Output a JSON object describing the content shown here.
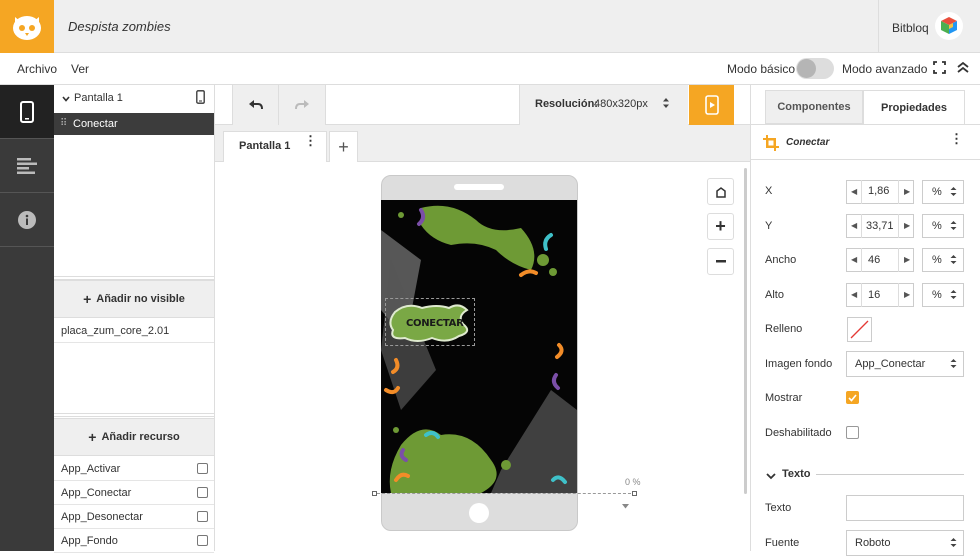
{
  "header": {
    "project_title": "Despista zombies",
    "user_name": "Bitbloq"
  },
  "menu": {
    "file": "Archivo",
    "view": "Ver",
    "mode_basic": "Modo básico",
    "mode_advanced": "Modo avanzado"
  },
  "tree": {
    "screen_label": "Pantalla 1",
    "selected_item": "Conectar"
  },
  "hidden": {
    "add_button": "Añadir no visible",
    "items": [
      "placa_zum_core_2.01"
    ]
  },
  "resources": {
    "add_button": "Añadir recurso",
    "items": [
      "App_Activar",
      "App_Conectar",
      "App_Desonectar",
      "App_Fondo"
    ]
  },
  "toolbar": {
    "resolution_label": "Resolución:",
    "resolution_value": "480x320px"
  },
  "tabs": {
    "screen_tab": "Pantalla 1"
  },
  "canvas": {
    "button_text": "CONECTAR",
    "percent_label": "0 %"
  },
  "panel": {
    "tab_components": "Componentes",
    "tab_properties": "Propiedades",
    "component_name": "Conectar",
    "x_label": "X",
    "x_value": "1,86",
    "y_label": "Y",
    "y_value": "33,71",
    "width_label": "Ancho",
    "width_value": "46",
    "height_label": "Alto",
    "height_value": "16",
    "unit": "%",
    "fill_label": "Relleno",
    "bg_image_label": "Imagen fondo",
    "bg_image_value": "App_Conectar",
    "show_label": "Mostrar",
    "show_checked": true,
    "disabled_label": "Deshabilitado",
    "disabled_checked": false,
    "text_section": "Texto",
    "text_label": "Texto",
    "text_value": "",
    "font_label": "Fuente",
    "font_value": "Roboto"
  },
  "colors": {
    "accent": "#f5a623",
    "nav_dark": "#3a3a3a",
    "splat_green": "#6e9a35"
  }
}
